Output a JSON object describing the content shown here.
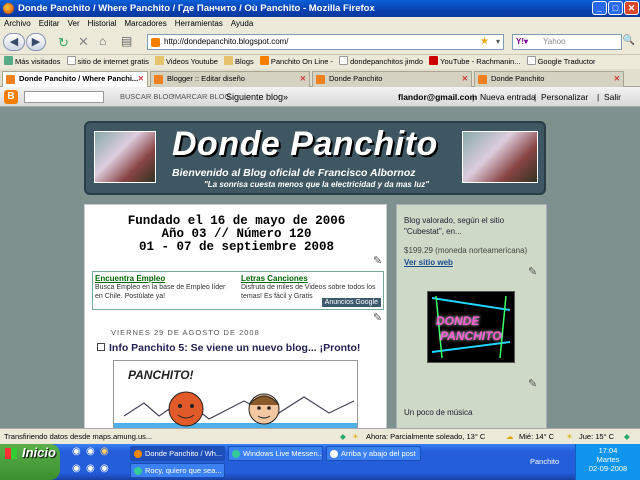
{
  "window": {
    "title": "Donde Panchito / Where Panchito / Где Панчито / Où Panchito - Mozilla Firefox"
  },
  "menu": [
    "Archivo",
    "Editar",
    "Ver",
    "Historial",
    "Marcadores",
    "Herramientas",
    "Ayuda"
  ],
  "nav": {
    "url": "http://dondepanchito.blogspot.com/",
    "search_placeholder": "Yahoo"
  },
  "bookmarks": [
    "Más visitados",
    "sitio de internet gratis",
    "Videos Youtube",
    "Blogs",
    "Panchito On Line -",
    "dondepanchitos jimdo",
    "YouTube - Rachmanin...",
    "Google Traductor"
  ],
  "tabs": [
    "Donde Panchito / Where Panchi...",
    "Blogger :: Editar diseño",
    "Donde Panchito",
    "Donde Panchito"
  ],
  "bloggerbar": {
    "search_btn": "BUSCAR BLOG",
    "mark_btn": "*MARCAR BLOG",
    "next": "Siguiente blog»",
    "email": "flandor@gmail.com",
    "new_post": "Nueva entrada",
    "customize": "Personalizar",
    "logout": "Salir"
  },
  "header": {
    "title": "Donde Panchito",
    "subtitle": "Bienvenido al Blog oficial de Francisco Albornoz",
    "quote": "\"La sonrisa cuesta menos que la electricidad y da mas luz\""
  },
  "main": {
    "founded": [
      "Fundado el 16 de mayo de 2006",
      "Año 03 // Número 120",
      "01 - 07 de septiembre 2008"
    ],
    "ads": {
      "ad1_title": "Encuentra Empleo",
      "ad1_text": "Busca Empleo en la base de Empleo líder en Chile. Postúlate ya!",
      "ad2_title": "Letras Canciones",
      "ad2_text": "Disfruta de miles de Videos sobre todos los temas! Es fácil y Gratis",
      "badge": "Anuncios Google"
    },
    "date": "VIERNES 29 DE AGOSTO DE 2008",
    "post_title": "Info Panchito 5: Se viene un nuevo blog... ¡Pronto!",
    "drawing_text": "PANCHITO!"
  },
  "side": {
    "valued": "Blog valorado, según el sitio \"Cubestat\", en...",
    "price": "$199.29",
    "currency": "(moneda norteamericana)",
    "link": "Ver sitio web",
    "logo_line1": "DONDE",
    "logo_line2": "PANCHITO",
    "music": "Un poco de música"
  },
  "status": {
    "text": "Transfiriendo datos desde maps.amung.us...",
    "weather_now": "Ahora: Parcialmente soleado, 13° C",
    "weather_wed": "Mié: 14° C",
    "weather_thu": "Jue: 15° C"
  },
  "taskbar": {
    "start": "Inicio",
    "tasks": [
      "Donde Panchito / Wh...",
      "Windows Live Messen...",
      "Arriba y abajo del post",
      "Rocy, quiero que sea..."
    ],
    "user": "Panchito",
    "time": "17:04",
    "day": "Martes",
    "date": "02-09-2008"
  }
}
